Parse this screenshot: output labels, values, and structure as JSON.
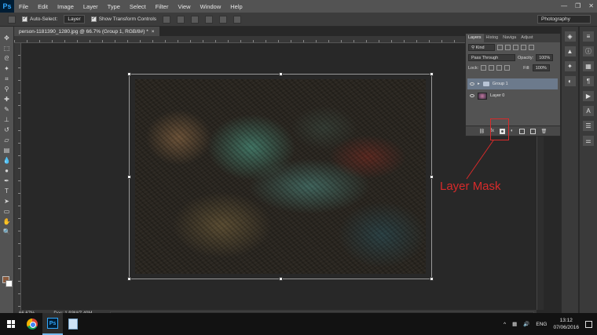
{
  "app": {
    "logo": "Ps"
  },
  "menu": [
    "File",
    "Edit",
    "Image",
    "Layer",
    "Type",
    "Select",
    "Filter",
    "View",
    "Window",
    "Help"
  ],
  "window_controls": [
    "—",
    "❐",
    "✕"
  ],
  "options_bar": {
    "tool_icon": "move-icon",
    "auto_select_label": "Auto-Select:",
    "auto_select_checked": true,
    "auto_select_target": "Layer",
    "show_transform_label": "Show Transform Controls",
    "show_transform_checked": true,
    "workspace": "Photography"
  },
  "document": {
    "tab_title": "person-1181390_1280.jpg @ 66.7% (Group 1, RGB/8#) *",
    "zoom": "66.67%",
    "doc_info": "Doc: 1.93M/7.40M"
  },
  "layers_panel": {
    "tabs": [
      "Layers",
      "Histog",
      "Naviga",
      "Adjust"
    ],
    "active_tab": "Layers",
    "filter_kind": "Kind",
    "blend_mode": "Pass Through",
    "opacity_label": "Opacity:",
    "opacity": "100%",
    "lock_label": "Lock:",
    "fill_label": "Fill:",
    "fill": "100%",
    "layers": [
      {
        "name": "Group 1",
        "type": "group",
        "selected": true,
        "visible": true
      },
      {
        "name": "Layer 0",
        "type": "image",
        "selected": false,
        "visible": true
      }
    ],
    "footer_icons": [
      "link-icon",
      "fx-icon",
      "layer-mask-icon",
      "adjustment-icon",
      "folder-icon",
      "new-layer-icon",
      "trash-icon"
    ]
  },
  "annotation": {
    "text": "Layer Mask",
    "color": "#d72a2a"
  },
  "colors": {
    "foreground": "#8b5a3c",
    "background": "#ffffff"
  },
  "taskbar": {
    "apps": [
      "chrome-icon",
      "photoshop-icon",
      "file-icon"
    ],
    "language": "ENG",
    "time": "13:12",
    "date": "07/06/2016"
  }
}
